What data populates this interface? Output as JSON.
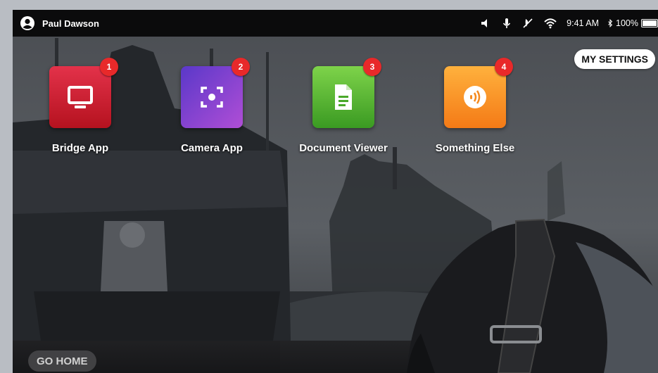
{
  "status_bar": {
    "user_name": "Paul Dawson",
    "time": "9:41 AM",
    "battery": "100%",
    "battery_level": 1.0,
    "icons": [
      "volume-icon",
      "microphone-icon",
      "mute-icon",
      "wifi-icon",
      "bluetooth-icon",
      "battery-icon"
    ]
  },
  "settings_button": "MY SETTINGS",
  "apps": [
    {
      "label": "Bridge App",
      "badge": "1",
      "icon": "monitor-icon",
      "color": "#d2263a"
    },
    {
      "label": "Camera App",
      "badge": "2",
      "icon": "camera-focus-icon",
      "color": "#7a40d0"
    },
    {
      "label": "Document Viewer",
      "badge": "3",
      "icon": "document-icon",
      "color": "#5cb833"
    },
    {
      "label": "Something Else",
      "badge": "4",
      "icon": "sound-wave-icon",
      "color": "#f89622"
    }
  ],
  "go_home": "GO HOME",
  "colors": {
    "badge": "#e8292a",
    "status_bar": "#0b0b0c"
  }
}
